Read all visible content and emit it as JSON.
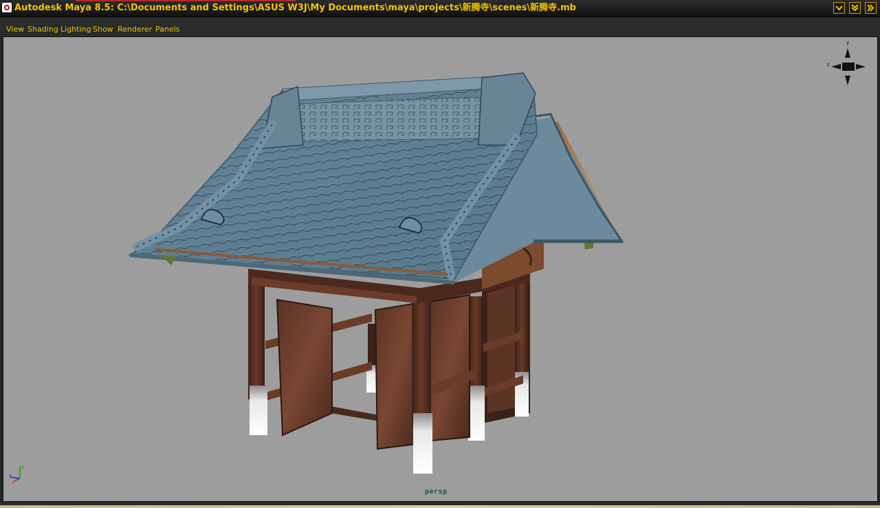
{
  "window": {
    "title": "Autodesk Maya 8.5: C:\\Documents and Settings\\ASUS W3J\\My Documents\\maya\\projects\\新腾寺\\scenes\\新腾寺.mb",
    "controls": [
      "chevron-down-icon",
      "double-chevron-down-icon",
      "double-chevron-right-icon"
    ]
  },
  "menubar": {
    "items": [
      {
        "label": "View"
      },
      {
        "label": "Shading"
      },
      {
        "label": "Lighting"
      },
      {
        "label": "Show"
      },
      {
        "label": "Renderer"
      },
      {
        "label": "Panels"
      }
    ]
  },
  "viewport": {
    "camera": "persp",
    "background_color": "#9d9d9d",
    "view_cube_labels": {
      "y": "y",
      "z": "z"
    },
    "axis_labels": {
      "y": "y",
      "z": "z",
      "x": "x"
    }
  },
  "colors": {
    "title_text": "#f5c400",
    "menu_text": "#e8c400",
    "camera_label": "#0f5c2e"
  }
}
